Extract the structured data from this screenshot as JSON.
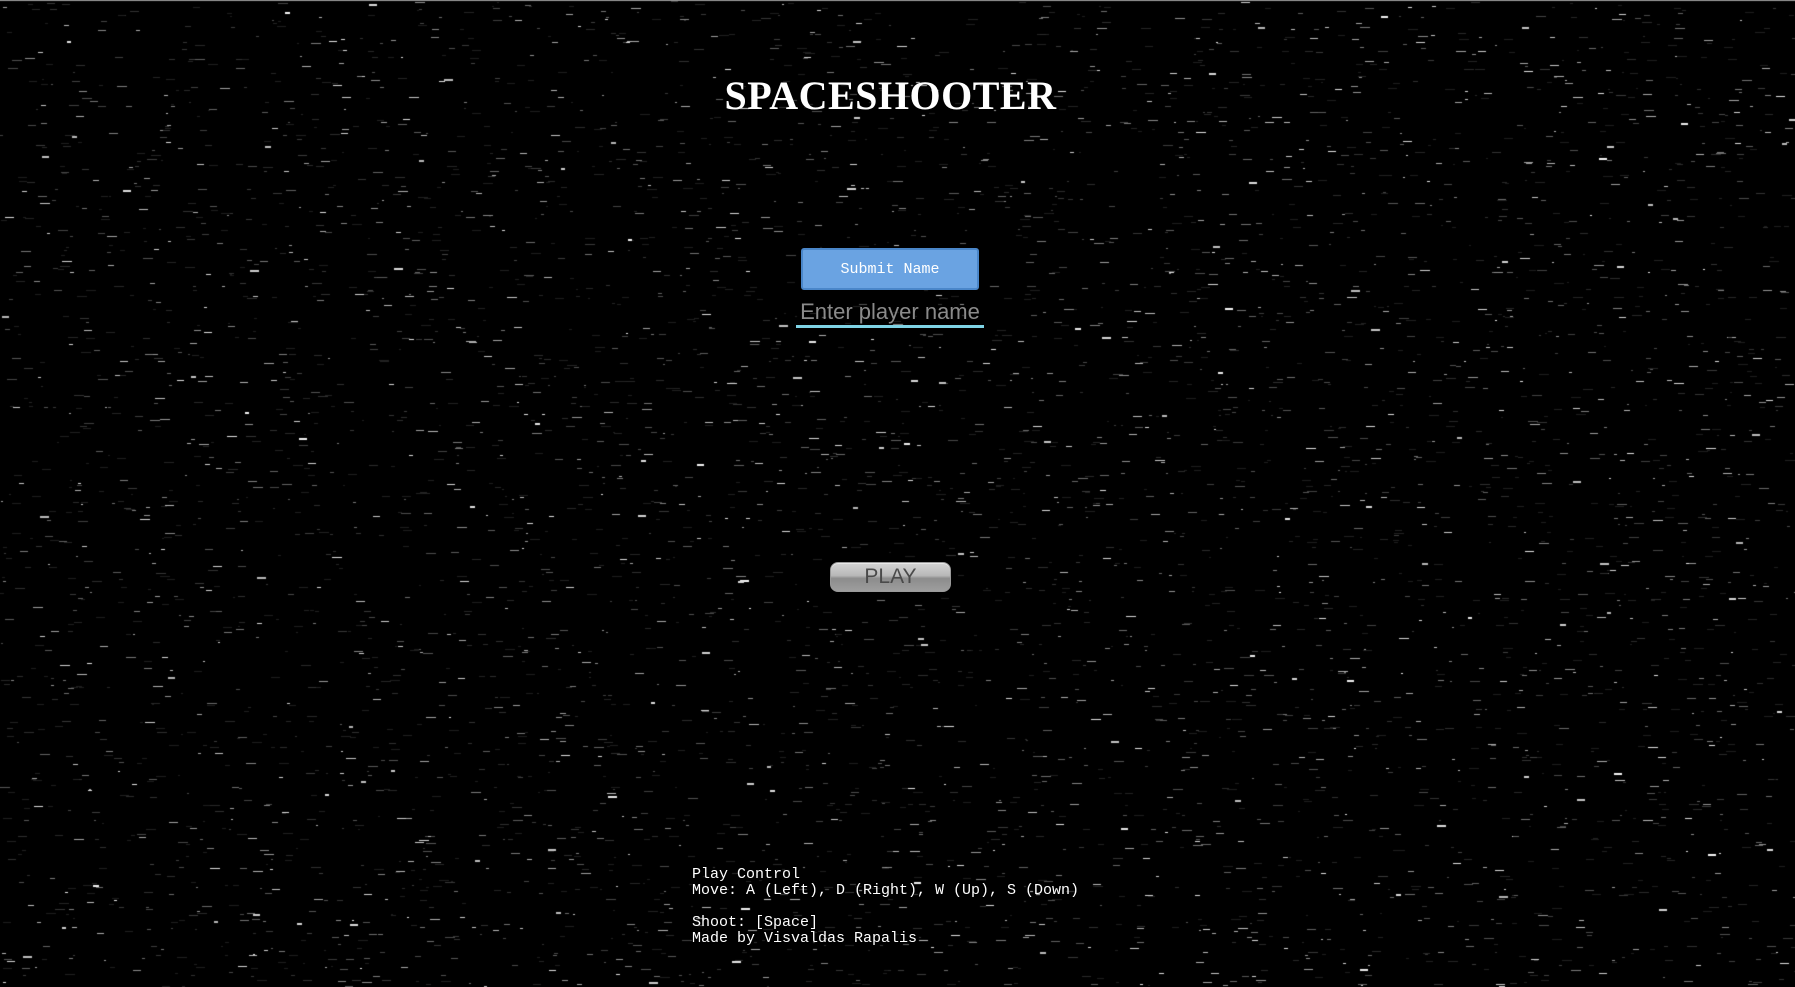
{
  "title": "SPACESHOOTER",
  "name_form": {
    "submit_label": "Submit Name",
    "input_placeholder": "Enter player name",
    "input_value": ""
  },
  "play_button_label": "PLAY",
  "controls": {
    "heading": "Play Control",
    "move": "Move: A (Left), D (Right), W (Up), S (Down)",
    "shoot": "Shoot: [Space]",
    "credit": "Made by Visvaldas Rapalis"
  },
  "colors": {
    "background": "#000000",
    "submit_button": "#6aa3e2",
    "input_underline": "#7fd4e6",
    "play_button": "#b8b8b8"
  }
}
